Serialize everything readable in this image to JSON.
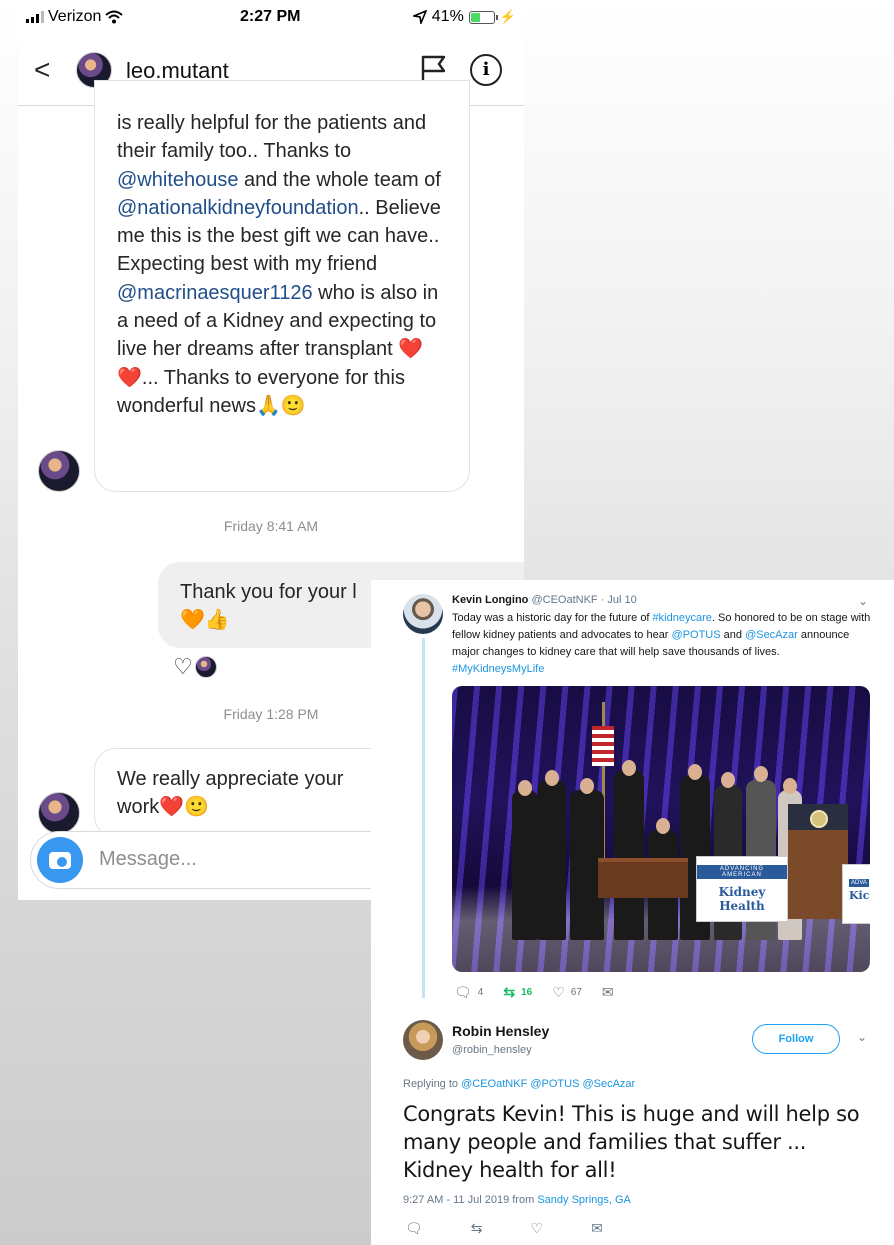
{
  "instagram": {
    "status": {
      "carrier": "Verizon",
      "time": "2:27 PM",
      "battery": "41%",
      "battery_level": 0.41
    },
    "header": {
      "username": "leo.mutant"
    },
    "messages": [
      {
        "parts": [
          {
            "text": "is really helpful for the patients and their family too.. Thanks to "
          },
          {
            "text": "@whitehouse",
            "mention": true
          },
          {
            "text": " and the whole team of "
          },
          {
            "text": "@nationalkidneyfoundation",
            "mention": true
          },
          {
            "text": ".. Believe me this is the best gift we can have.. Expecting best with my friend "
          },
          {
            "text": "@macrinaesquer1126",
            "mention": true
          },
          {
            "text": " who is also in a need of a Kidney and expecting to live her dreams after transplant ❤️❤️... Thanks to everyone for this wonderful news🙏🙂"
          }
        ]
      },
      {
        "text": "Thank you for your l\n🧡👍"
      },
      {
        "text": "We really appreciate your\nwork❤️🙂"
      }
    ],
    "timestamps": [
      "Friday 8:41 AM",
      "Friday 1:28 PM"
    ],
    "composer": {
      "placeholder": "Message..."
    }
  },
  "twitter": {
    "tweet1": {
      "name": "Kevin Longino",
      "handle": "@CEOatNKF",
      "date": "· Jul 10",
      "parts": [
        {
          "text": "Today was a historic day for the future of "
        },
        {
          "text": "#kidneycare",
          "link": true
        },
        {
          "text": ". So honored to be on stage with fellow kidney patients and advocates to hear "
        },
        {
          "text": "@POTUS",
          "link": true
        },
        {
          "text": " and "
        },
        {
          "text": "@SecAzar",
          "link": true
        },
        {
          "text": " announce major changes to kidney care that will help save thousands of lives. "
        },
        {
          "text": "#MyKidneysMyLife",
          "link": true
        }
      ],
      "sign_small": "ADVANCING AMERICAN",
      "sign_title": "Kidney Health",
      "sign2_small": "ADVA",
      "sign2_title": "Kic",
      "replies": "4",
      "retweets": "16",
      "likes": "67"
    },
    "reply": {
      "name": "Robin Hensley",
      "handle": "@robin_hensley",
      "follow": "Follow",
      "replying_to_label": "Replying to",
      "replying_to": "@CEOatNKF @POTUS @SecAzar",
      "body": "Congrats Kevin! This is huge and will help so many people and families that suffer ... Kidney health for all!",
      "time": "9:27 AM - 11 Jul 2019 from",
      "location": "Sandy Springs, GA"
    },
    "colors": {
      "link": "#1b95e0",
      "retweet": "#17bf63",
      "thread": "#c4e3f6"
    }
  }
}
